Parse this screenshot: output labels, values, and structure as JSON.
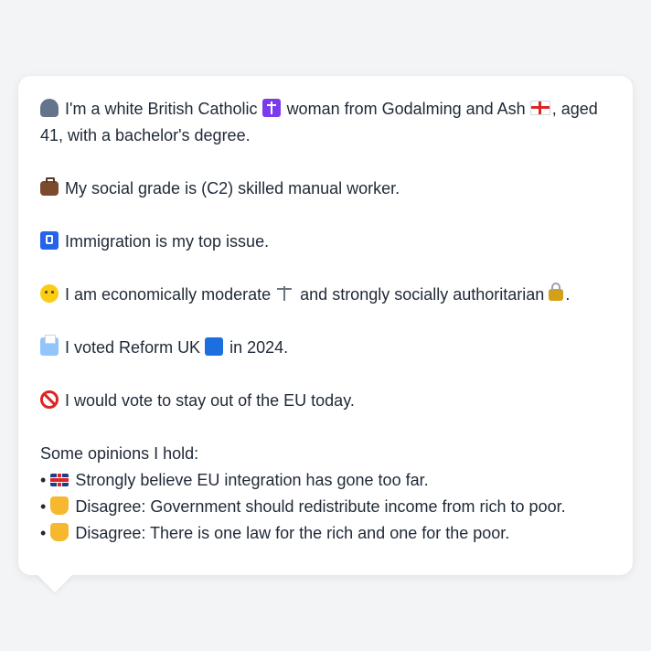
{
  "profile": {
    "intro_text_1": "I'm a white British Catholic",
    "intro_text_2": "woman from Godalming and Ash",
    "intro_text_3": ", aged 41, with a bachelor's degree.",
    "social_grade": "My social grade is (C2) skilled manual worker.",
    "top_issue": "Immigration is my top issue.",
    "economic_text_1": "I am economically moderate",
    "economic_text_2": "and strongly socially authoritarian",
    "economic_text_3": ".",
    "voted_text_1": "I voted Reform UK",
    "voted_text_2": "in 2024.",
    "eu_vote": "I would vote to stay out of the EU today."
  },
  "opinions": {
    "heading": "Some opinions I hold:",
    "bullet": "•",
    "items": [
      {
        "icon": "uk-flag-icon",
        "text": "Strongly believe EU integration has gone too far."
      },
      {
        "icon": "thumbs-down-icon",
        "text": "Disagree: Government should redistribute income from rich to poor."
      },
      {
        "icon": "thumbs-down-icon",
        "text": "Disagree: There is one law for the rich and one for the poor."
      }
    ]
  },
  "icons": {
    "person": "person-icon",
    "religion": "latin-cross-icon",
    "region": "england-flag-icon",
    "job": "briefcase-icon",
    "issue": "passport-control-icon",
    "thinking": "thinking-face-icon",
    "balance": "scales-icon",
    "authority": "lock-icon",
    "vote": "ballot-box-icon",
    "party_colour": "#1d6fe0",
    "eu": "prohibited-icon"
  }
}
